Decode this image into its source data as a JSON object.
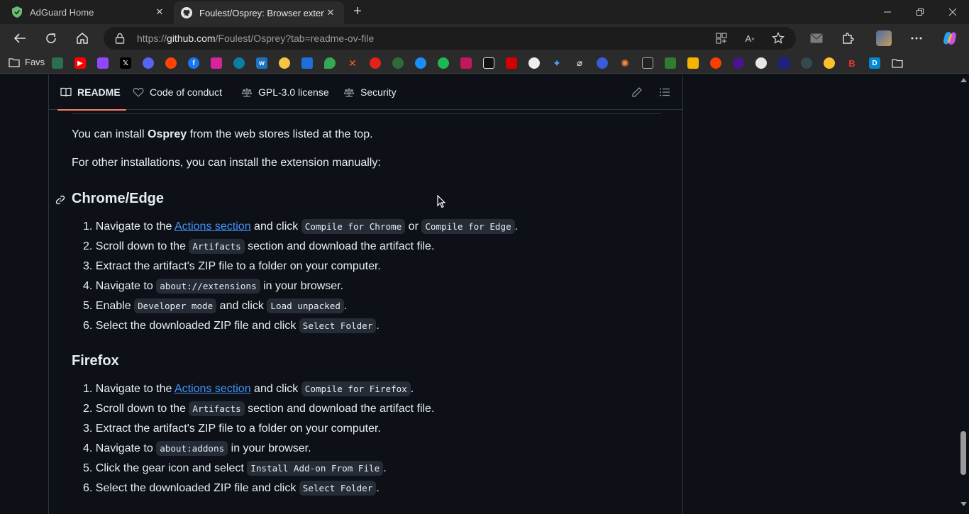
{
  "tabs": [
    {
      "title": "AdGuard Home",
      "close": "✕"
    },
    {
      "title": "Foulest/Osprey: Browser extension",
      "close": "✕"
    }
  ],
  "new_tab": "+",
  "address": {
    "scheme": "https://",
    "host": "github.com",
    "path": "/Foulest/Osprey?tab=readme-ov-file"
  },
  "favorites": {
    "label": "Favs"
  },
  "readme_tabs": [
    "README",
    "Code of conduct",
    "GPL-3.0 license",
    "Security"
  ],
  "intro": {
    "p1_before": "You can install ",
    "p1_bold": "Osprey",
    "p1_after": " from the web stores listed at the top.",
    "p2": "For other installations, you can install the extension manually:"
  },
  "chrome": {
    "heading": "Chrome/Edge",
    "steps": [
      {
        "n": "1.",
        "a": "Navigate to the ",
        "link": "Actions section",
        "b": " and click ",
        "code1": "Compile for Chrome",
        "c": " or ",
        "code2": "Compile for Edge",
        "d": "."
      },
      {
        "n": "2.",
        "a": "Scroll down to the ",
        "code1": "Artifacts",
        "b": " section and download the artifact file."
      },
      {
        "n": "3.",
        "a": "Extract the artifact's ZIP file to a folder on your computer."
      },
      {
        "n": "4.",
        "a": "Navigate to ",
        "code1": "about://extensions",
        "b": " in your browser."
      },
      {
        "n": "5.",
        "a": "Enable ",
        "code1": "Developer mode",
        "b": " and click ",
        "code2": "Load unpacked",
        "c": "."
      },
      {
        "n": "6.",
        "a": "Select the downloaded ZIP file and click ",
        "code1": "Select Folder",
        "b": "."
      }
    ]
  },
  "firefox": {
    "heading": "Firefox",
    "steps": [
      {
        "n": "1.",
        "a": "Navigate to the ",
        "link": "Actions section",
        "b": " and click ",
        "code1": "Compile for Firefox",
        "c": "."
      },
      {
        "n": "2.",
        "a": "Scroll down to the ",
        "code1": "Artifacts",
        "b": " section and download the artifact file."
      },
      {
        "n": "3.",
        "a": "Extract the artifact's ZIP file to a folder on your computer."
      },
      {
        "n": "4.",
        "a": "Navigate to ",
        "code1": "about:addons",
        "b": " in your browser."
      },
      {
        "n": "5.",
        "a": "Click the gear icon and select ",
        "code1": "Install Add-on From File",
        "b": "."
      },
      {
        "n": "6.",
        "a": "Select the downloaded ZIP file and click ",
        "code1": "Select Folder",
        "b": "."
      }
    ]
  },
  "colors": {
    "accent": "#f78166",
    "link": "#4493f8",
    "bg": "#0d1117"
  }
}
